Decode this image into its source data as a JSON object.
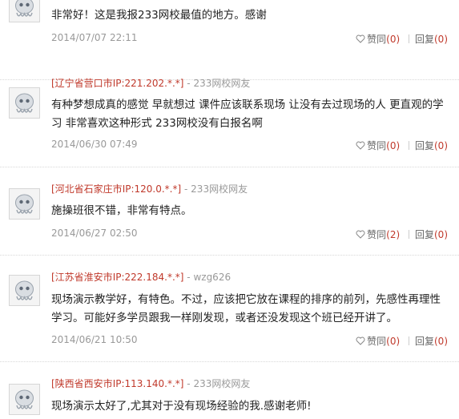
{
  "comments": [
    {
      "avatar_icon": "default-user-avatar-icon",
      "location": "",
      "ip": "",
      "user": "",
      "text": "非常好！这是我报233网校最值的地方。感谢",
      "date": "2014/07/07 22:11",
      "like_label": "赞同",
      "like_count": "(0)",
      "reply_label": "回复",
      "reply_count": "(0)"
    },
    {
      "avatar_icon": "default-user-avatar-icon",
      "location": "[辽宁省营口市",
      "ip": "IP:221.202.*.*]",
      "user": "233网校网友",
      "text": "有种梦想成真的感觉 早就想过 课件应该联系现场 让没有去过现场的人 更直观的学习 非常喜欢这种形式 233网校没有白报名啊",
      "date": "2014/06/30 07:49",
      "like_label": "赞同",
      "like_count": "(0)",
      "reply_label": "回复",
      "reply_count": "(0)"
    },
    {
      "avatar_icon": "default-user-avatar-icon",
      "location": "[河北省石家庄市",
      "ip": "IP:120.0.*.*]",
      "user": "233网校网友",
      "text": "施操班很不错，非常有特点。",
      "date": "2014/06/27 02:50",
      "like_label": "赞同",
      "like_count": "(2)",
      "reply_label": "回复",
      "reply_count": "(0)"
    },
    {
      "avatar_icon": "default-user-avatar-icon",
      "location": "[江苏省淮安市",
      "ip": "IP:222.184.*.*]",
      "user": "wzg626",
      "text": "现场演示教学好，有特色。不过，应该把它放在课程的排序的前列，先感性再理性学习。可能好多学员跟我一样刚发现，或者还没发现这个班已经开讲了。",
      "date": "2014/06/21 10:50",
      "like_label": "赞同",
      "like_count": "(0)",
      "reply_label": "回复",
      "reply_count": "(0)"
    },
    {
      "avatar_icon": "default-user-avatar-icon",
      "location": "[陕西省西安市",
      "ip": "IP:113.140.*.*]",
      "user": "233网校网友",
      "text": "现场演示太好了,尤其对于没有现场经验的我.感谢老师!",
      "date": "",
      "like_label": "",
      "like_count": "",
      "reply_label": "",
      "reply_count": ""
    }
  ],
  "separator": "-",
  "colors": {
    "location": "#c0392b",
    "meta": "#999999",
    "text": "#222222",
    "count": "#c0392b"
  }
}
